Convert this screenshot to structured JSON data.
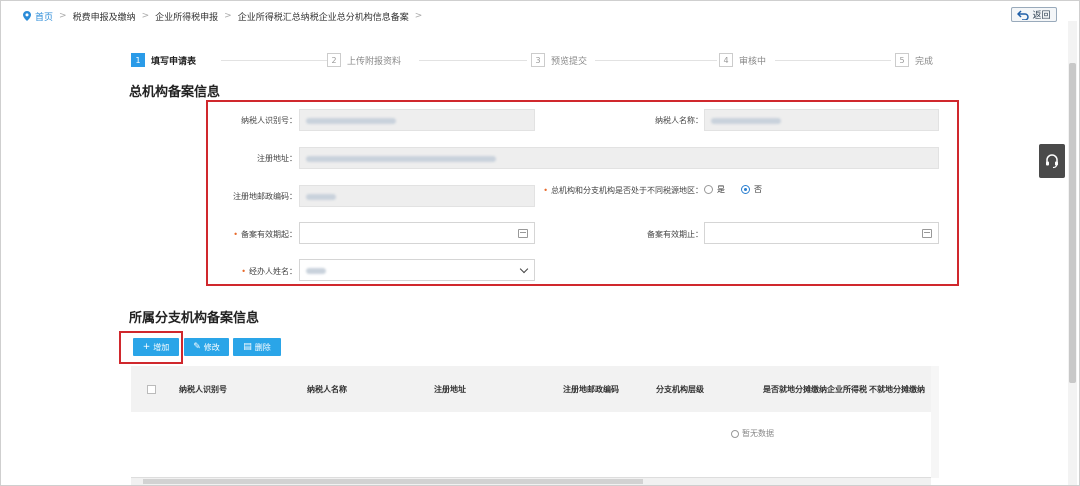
{
  "breadcrumb": {
    "home": "首页",
    "items": [
      "税费申报及缴纳",
      "企业所得税申报",
      "企业所得税汇总纳税企业总分机构信息备案"
    ]
  },
  "back_label": "返回",
  "steps": [
    {
      "num": "1",
      "label": "填写申请表"
    },
    {
      "num": "2",
      "label": "上传附报资料"
    },
    {
      "num": "3",
      "label": "预览提交"
    },
    {
      "num": "4",
      "label": "审核中"
    },
    {
      "num": "5",
      "label": "完成"
    }
  ],
  "head_section": {
    "title": "总机构备案信息",
    "labels": {
      "taxpayer_id": "纳税人识别号：",
      "taxpayer_name": "纳税人名称：",
      "address": "注册地址：",
      "postcode": "注册地邮政编码：",
      "diff_region": "总机构和分支机构是否处于不同税源地区：",
      "valid_from": "备案有效期起：",
      "valid_to": "备案有效期止：",
      "agent": "经办人姓名："
    },
    "radio": {
      "yes": "是",
      "no": "否",
      "selected": "no"
    }
  },
  "branch_section": {
    "title": "所属分支机构备案信息",
    "buttons": {
      "add": "增加",
      "edit": "修改",
      "delete": "删除"
    },
    "columns": [
      "纳税人识别号",
      "纳税人名称",
      "注册地址",
      "注册地邮政编码",
      "分支机构层级",
      "是否就地分摊缴纳企业所得税",
      "不就地分摊缴纳"
    ],
    "empty_text": "暂无数据"
  },
  "colors": {
    "accent": "#2aa5e8",
    "highlight": "#d0282d",
    "required": "#e8692a"
  }
}
